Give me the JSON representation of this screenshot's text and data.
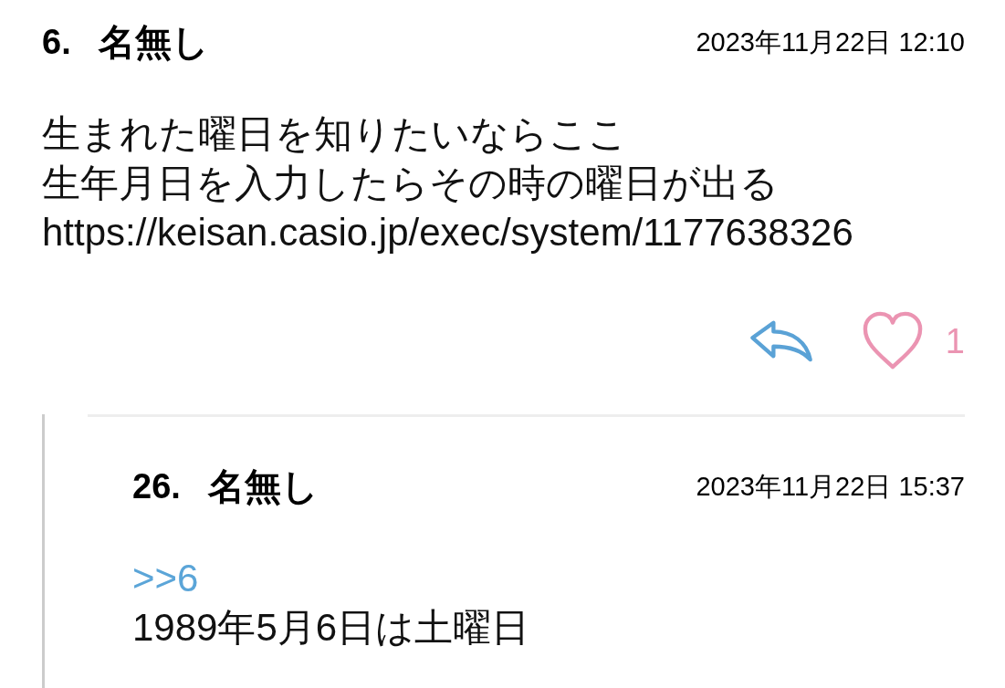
{
  "thread": [
    {
      "number": "6.",
      "author": "名無し",
      "posted_at": "2023年11月22日 12:10",
      "body": [
        "生まれた曜日を知りたいならここ",
        "生年月日を入力したらその時の曜日が出る",
        "https://keisan.casio.jp/exec/system/1177638326"
      ],
      "like_count": "1",
      "replies": [
        {
          "number": "26.",
          "author": "名無し",
          "posted_at": "2023年11月22日 15:37",
          "anchor": ">>6",
          "body": [
            "1989年5月6日は土曜日"
          ]
        }
      ]
    }
  ]
}
